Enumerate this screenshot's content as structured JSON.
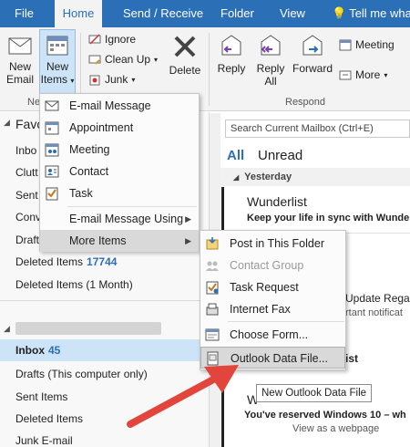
{
  "tabs": [
    "File",
    "Home",
    "Send / Receive",
    "Folder",
    "View",
    "Tell me what"
  ],
  "ribbon": {
    "new_email": "New\nEmail",
    "new_email_l1": "New",
    "new_email_l2": "Email",
    "new_items_l1": "New",
    "new_items_l2": "Items",
    "ignore": "Ignore",
    "clean_up": "Clean Up",
    "junk": "Junk",
    "delete": "Delete",
    "reply": "Reply",
    "reply_all_l1": "Reply",
    "reply_all_l2": "All",
    "forward": "Forward",
    "meeting": "Meeting",
    "more": "More",
    "group_new_partial": "Ne",
    "group_respond": "Respond"
  },
  "nav": {
    "favorites_partial": "Favo",
    "fav_items": [
      "Inbo",
      "Clutt",
      "Sent",
      "Conv",
      "Draft"
    ],
    "deleted_items": "Deleted Items",
    "deleted_count": "17744",
    "deleted_month": "Deleted Items (1 Month)",
    "inbox": "Inbox",
    "inbox_count": "45",
    "drafts": "Drafts (This computer only)",
    "sent": "Sent Items",
    "deleted2": "Deleted Items",
    "junk": "Junk E-mail"
  },
  "search": {
    "placeholder": "Search Current Mailbox (Ctrl+E)"
  },
  "filters": {
    "all": "All",
    "unread": "Unread"
  },
  "group": {
    "yesterday": "Yesterday"
  },
  "messages": {
    "m1_from": "Wunderlist",
    "m1_subject": "Keep your life in sync with Wunde",
    "m2_subject_partial": "Update Rega",
    "m2_line2_partial": "rtant notificat",
    "m3_partial": "ist",
    "m4_from_partial": "W",
    "m4_subject": "You've reserved Windows 10 – wh",
    "m4_view": "View as a webpage"
  },
  "new_items_menu": {
    "items": [
      "E-mail Message",
      "Appointment",
      "Meeting",
      "Contact",
      "Task"
    ],
    "email_using": "E-mail Message Using",
    "more_items": "More Items"
  },
  "more_items_menu": {
    "items": [
      "Post in This Folder",
      "Contact Group",
      "Task Request",
      "Internet Fax",
      "Choose Form...",
      "Outlook Data File..."
    ]
  },
  "tooltip": "New Outlook Data File",
  "colors": {
    "brand": "#2b6fb6",
    "arrow": "#e2453b"
  }
}
